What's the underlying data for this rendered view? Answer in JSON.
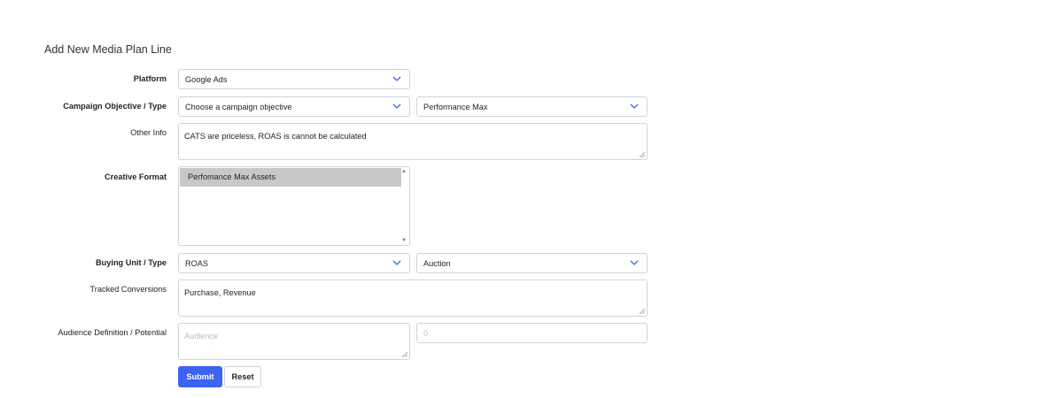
{
  "form": {
    "title": "Add New Media Plan Line",
    "platform": {
      "label": "Platform",
      "value": "Google Ads"
    },
    "campaign": {
      "label": "Campaign Objective / Type",
      "objective": "Choose a campaign objective",
      "type": "Performance Max"
    },
    "other_info": {
      "label": "Other Info",
      "value": "CATS are priceless, ROAS is cannot be calculated"
    },
    "creative_format": {
      "label": "Creative Format",
      "options": [
        "Perfomance Max Assets"
      ]
    },
    "buying": {
      "label": "Buying Unit / Type",
      "unit": "ROAS",
      "type": "Auction"
    },
    "tracked_conversions": {
      "label": "Tracked Conversions",
      "value": "Purchase, Revenue"
    },
    "audience": {
      "label": "Audience Definition / Potential",
      "definition_placeholder": "Audience",
      "potential_placeholder": "0"
    },
    "submit_label": "Submit",
    "reset_label": "Reset"
  },
  "colors": {
    "primary": "#3d63f2",
    "chevron": "#3d63f2",
    "selected_option": "#c8c8c8"
  },
  "icons": {
    "dropdown": "chevron-down-icon",
    "resize": "resize-handle-icon"
  }
}
